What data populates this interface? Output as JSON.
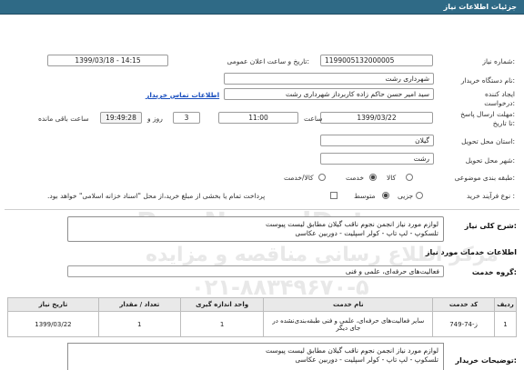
{
  "header": {
    "title": "جزئیات اطلاعات نیاز"
  },
  "need_number": {
    "label": "شماره نیاز:",
    "value": "1199005132000005"
  },
  "announce": {
    "label": "تاریخ و ساعت اعلان عمومی:",
    "value": "1399/03/18 - 14:15"
  },
  "buyer_org": {
    "label": "نام دستگاه خریدار:",
    "value": "شهرداری رشت"
  },
  "requester": {
    "label": "ایجاد کننده درخواست:",
    "value": "سید امیر حسن حاکم زاده کاربرداز  شهرداری رشت",
    "contact_link": "اطلاعات تماس خریدار"
  },
  "deadline": {
    "label": "مهلت ارسال پاسخ: تا تاریخ:",
    "date": "1399/03/22",
    "time_label": "ساعت",
    "time": "11:00",
    "days": "3",
    "days_label": "روز و",
    "remaining": "19:49:28",
    "remaining_label": "ساعت باقی مانده"
  },
  "province": {
    "label": "استان محل تحویل:",
    "value": "گیلان"
  },
  "city": {
    "label": "شهر محل تحویل:",
    "value": "رشت"
  },
  "category": {
    "label": "طبقه بندی موضوعی:",
    "options": [
      "کالا",
      "خدمت",
      "کالا/خدمت"
    ],
    "selected": "خدمت"
  },
  "process": {
    "label": "نوع فرآیند خرید :",
    "options": [
      "جزیی",
      "متوسط"
    ],
    "selected": "متوسط",
    "payment_note": "پرداخت تمام یا بخشی از مبلغ خرید،از محل \"اسناد خزانه اسلامی\" خواهد بود."
  },
  "summary": {
    "label": "شرح کلی نیاز:",
    "line1": "لوازم مورد نیاز انجمن نجوم ناقب گیلان مطابق لیست پیوست",
    "line2": "تلسکوپ - لپ تاپ - کولر اسپلیت - دوربین عکاسی"
  },
  "services_title": "اطلاعات خدمات مورد نیاز",
  "service_group": {
    "label": "گروه خدمت:",
    "value": "فعالیت‌های حرفه‌ای، علمی و فنی"
  },
  "table": {
    "headers": [
      "ردیف",
      "کد خدمت",
      "نام خدمت",
      "واحد اندازه گیری",
      "تعداد / مقدار",
      "تاریخ نیاز"
    ],
    "rows": [
      {
        "row": "1",
        "code": "ز-74-749",
        "name": "سایر فعالیت‌های حرفه‌ای، علمی و فنی طبقه‌بندی‌نشده در جای دیگر",
        "unit": "1",
        "qty": "1",
        "date": "1399/03/22"
      }
    ]
  },
  "buyer_notes": {
    "label": "توضیحات خریدار:",
    "line1": "لوازم مورد نیاز انجمن نجوم ناقب گیلان مطابق لیست پیوست",
    "line2": "تلسکوپ - لپ تاپ - کولر اسپلیت - دوربین عکاسی"
  },
  "watermark": {
    "brand": "ParsNamadData",
    "line2": "مرکز اطلاع رسانی مناقصه و مزایده",
    "phone": "۰۲۱-۸۸۳۴۹۶۷۰-۵"
  }
}
